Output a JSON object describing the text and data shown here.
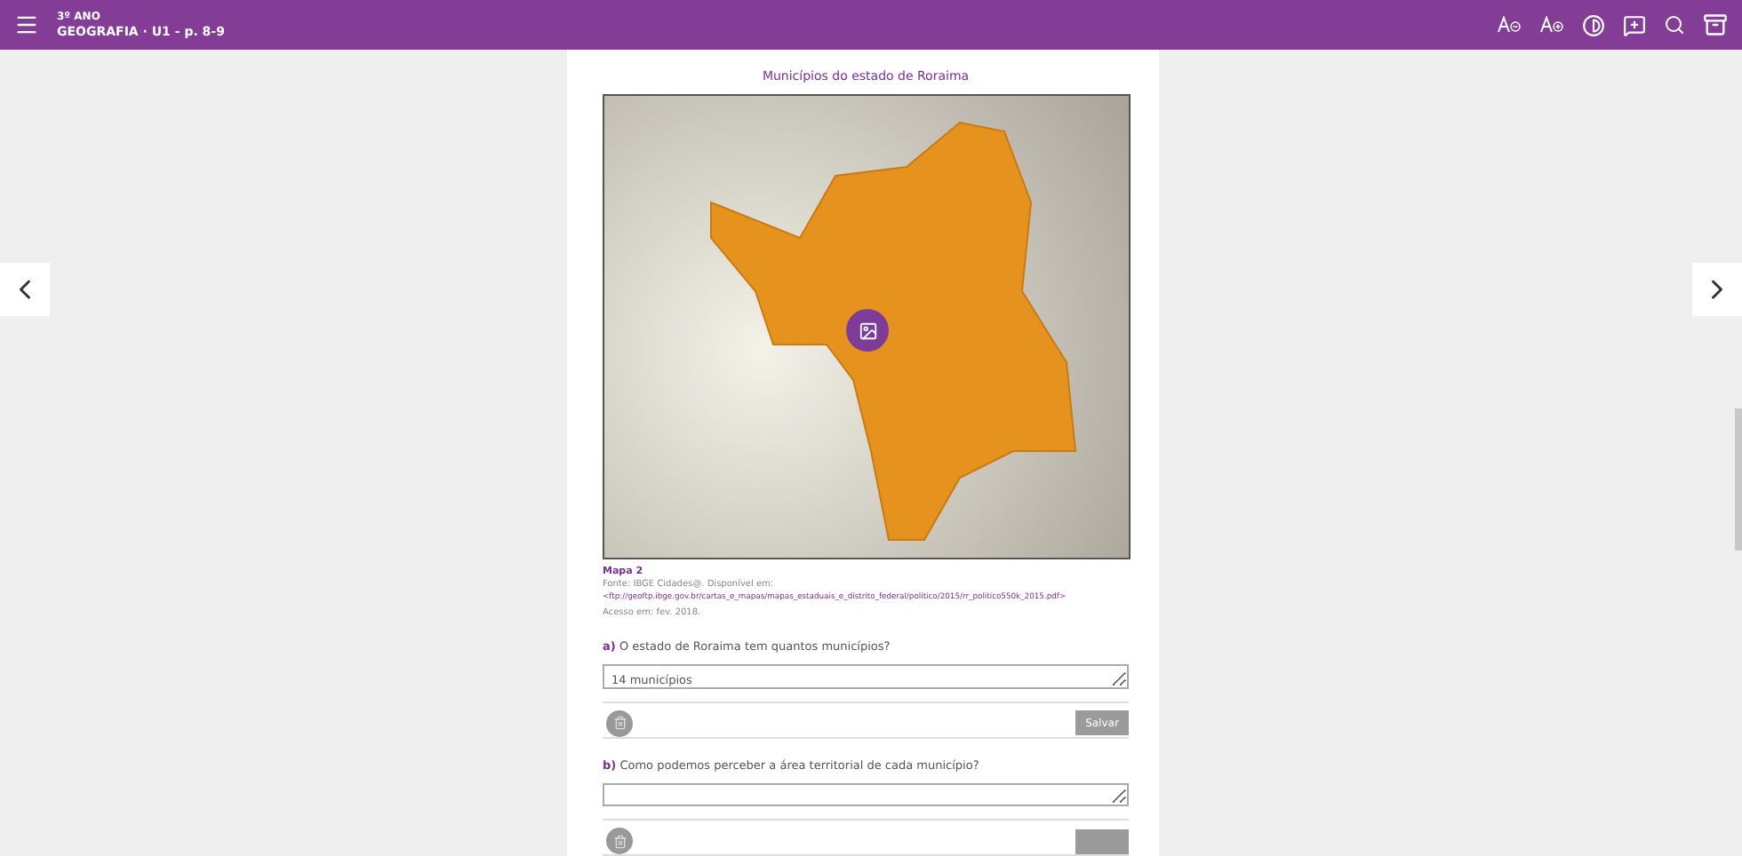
{
  "top_bar": {
    "grade": "3º ANO",
    "title": "GEOGRAFIA · U1 - p. 8-9"
  },
  "figure": {
    "title": "Municípios do estado de Roraima",
    "label": "Mapa 2",
    "source": "Fonte: IBGE Cidades@. Disponível em:",
    "link": "<ftp://geoftp.ibge.gov.br/cartas_e_mapas/mapas_estaduais_e_distrito_federal/politico/2015/rr_politico550k_2015.pdf>",
    "access": "Acesso em: fev. 2018."
  },
  "questions": [
    {
      "letter": "a)",
      "text": "O estado de Roraima tem quantos municípios?",
      "answer": "14 municípios",
      "button": "Salvar"
    },
    {
      "letter": "b)",
      "text": "Como podemos perceber a área territorial de cada município?"
    }
  ]
}
